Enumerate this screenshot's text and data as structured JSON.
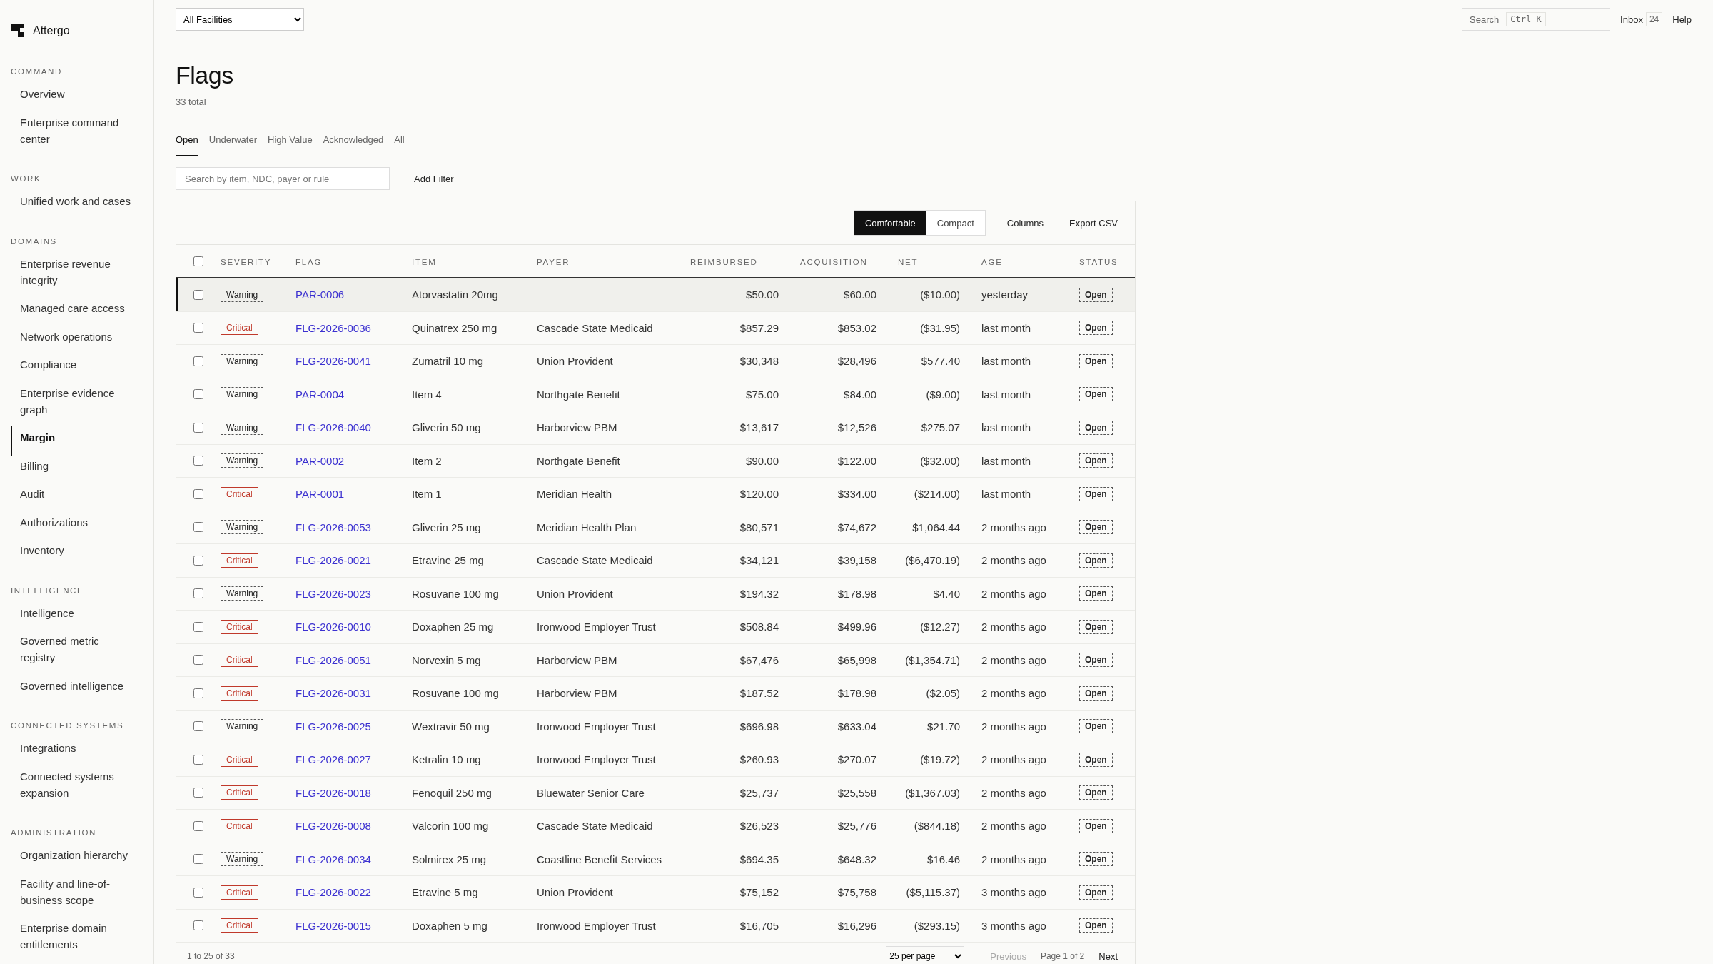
{
  "brand": {
    "name": "Attergo"
  },
  "sidebar": {
    "sections": [
      {
        "heading": "COMMAND",
        "items": [
          {
            "label": "Overview",
            "selected": false
          },
          {
            "label": "Enterprise command center",
            "selected": false
          }
        ]
      },
      {
        "heading": "WORK",
        "items": [
          {
            "label": "Unified work and cases",
            "selected": false
          }
        ]
      },
      {
        "heading": "DOMAINS",
        "items": [
          {
            "label": "Enterprise revenue integrity",
            "selected": false
          },
          {
            "label": "Managed care access",
            "selected": false
          },
          {
            "label": "Network operations",
            "selected": false
          },
          {
            "label": "Compliance",
            "selected": false
          },
          {
            "label": "Enterprise evidence graph",
            "selected": false
          },
          {
            "label": "Margin",
            "selected": true
          },
          {
            "label": "Billing",
            "selected": false
          },
          {
            "label": "Audit",
            "selected": false
          },
          {
            "label": "Authorizations",
            "selected": false
          },
          {
            "label": "Inventory",
            "selected": false
          }
        ]
      },
      {
        "heading": "INTELLIGENCE",
        "items": [
          {
            "label": "Intelligence",
            "selected": false
          },
          {
            "label": "Governed metric registry",
            "selected": false
          },
          {
            "label": "Governed intelligence",
            "selected": false
          }
        ]
      },
      {
        "heading": "CONNECTED SYSTEMS",
        "items": [
          {
            "label": "Integrations",
            "selected": false
          },
          {
            "label": "Connected systems expansion",
            "selected": false
          }
        ]
      },
      {
        "heading": "ADMINISTRATION",
        "items": [
          {
            "label": "Organization hierarchy",
            "selected": false
          },
          {
            "label": "Facility and line-of-business scope",
            "selected": false
          },
          {
            "label": "Enterprise domain entitlements",
            "selected": false
          }
        ]
      }
    ]
  },
  "topbar": {
    "facility_select": "All Facilities",
    "search": {
      "placeholder": "Search",
      "shortcut": "Ctrl K"
    },
    "inbox": {
      "label": "Inbox",
      "count": "24"
    },
    "help": "Help"
  },
  "page": {
    "title": "Flags",
    "subtitle": "33 total"
  },
  "tabs": [
    {
      "label": "Open",
      "selected": true
    },
    {
      "label": "Underwater",
      "selected": false
    },
    {
      "label": "High Value",
      "selected": false
    },
    {
      "label": "Acknowledged",
      "selected": false
    },
    {
      "label": "All",
      "selected": false
    }
  ],
  "filter": {
    "search": {
      "placeholder": "Search by item, NDC, payer or rule"
    },
    "add_filter": "Add Filter"
  },
  "toolbar": {
    "density": [
      {
        "label": "Comfortable",
        "selected": true
      },
      {
        "label": "Compact",
        "selected": false
      }
    ],
    "columns": "Columns",
    "export": "Export CSV"
  },
  "table": {
    "select_all": {
      "checked": false
    },
    "columns": [
      "SEVERITY",
      "FLAG",
      "ITEM",
      "PAYER",
      "REIMBURSED",
      "ACQUISITION",
      "NET",
      "AGE",
      "STATUS"
    ],
    "rows": [
      {
        "selected": true,
        "checked": false,
        "severity": {
          "label": "Warning",
          "kind": "warning"
        },
        "flag": "PAR-0006",
        "item": "Atorvastatin 20mg",
        "payer": "–",
        "reimbursed": "$50.00",
        "acquisition": "$60.00",
        "net": "($10.00)",
        "age": "yesterday",
        "status": "Open"
      },
      {
        "selected": false,
        "checked": false,
        "severity": {
          "label": "Critical",
          "kind": "critical"
        },
        "flag": "FLG-2026-0036",
        "item": "Quinatrex 250 mg",
        "payer": "Cascade State Medicaid",
        "reimbursed": "$857.29",
        "acquisition": "$853.02",
        "net": "($31.95)",
        "age": "last month",
        "status": "Open"
      },
      {
        "selected": false,
        "checked": false,
        "severity": {
          "label": "Warning",
          "kind": "warning"
        },
        "flag": "FLG-2026-0041",
        "item": "Zumatril 10 mg",
        "payer": "Union Provident",
        "reimbursed": "$30,348",
        "acquisition": "$28,496",
        "net": "$577.40",
        "age": "last month",
        "status": "Open"
      },
      {
        "selected": false,
        "checked": false,
        "severity": {
          "label": "Warning",
          "kind": "warning"
        },
        "flag": "PAR-0004",
        "item": "Item 4",
        "payer": "Northgate Benefit",
        "reimbursed": "$75.00",
        "acquisition": "$84.00",
        "net": "($9.00)",
        "age": "last month",
        "status": "Open"
      },
      {
        "selected": false,
        "checked": false,
        "severity": {
          "label": "Warning",
          "kind": "warning"
        },
        "flag": "FLG-2026-0040",
        "item": "Gliverin 50 mg",
        "payer": "Harborview PBM",
        "reimbursed": "$13,617",
        "acquisition": "$12,526",
        "net": "$275.07",
        "age": "last month",
        "status": "Open"
      },
      {
        "selected": false,
        "checked": false,
        "severity": {
          "label": "Warning",
          "kind": "warning"
        },
        "flag": "PAR-0002",
        "item": "Item 2",
        "payer": "Northgate Benefit",
        "reimbursed": "$90.00",
        "acquisition": "$122.00",
        "net": "($32.00)",
        "age": "last month",
        "status": "Open"
      },
      {
        "selected": false,
        "checked": false,
        "severity": {
          "label": "Critical",
          "kind": "critical"
        },
        "flag": "PAR-0001",
        "item": "Item 1",
        "payer": "Meridian Health",
        "reimbursed": "$120.00",
        "acquisition": "$334.00",
        "net": "($214.00)",
        "age": "last month",
        "status": "Open"
      },
      {
        "selected": false,
        "checked": false,
        "severity": {
          "label": "Warning",
          "kind": "warning"
        },
        "flag": "FLG-2026-0053",
        "item": "Gliverin 25 mg",
        "payer": "Meridian Health Plan",
        "reimbursed": "$80,571",
        "acquisition": "$74,672",
        "net": "$1,064.44",
        "age": "2 months ago",
        "status": "Open"
      },
      {
        "selected": false,
        "checked": false,
        "severity": {
          "label": "Critical",
          "kind": "critical"
        },
        "flag": "FLG-2026-0021",
        "item": "Etravine 25 mg",
        "payer": "Cascade State Medicaid",
        "reimbursed": "$34,121",
        "acquisition": "$39,158",
        "net": "($6,470.19)",
        "age": "2 months ago",
        "status": "Open"
      },
      {
        "selected": false,
        "checked": false,
        "severity": {
          "label": "Warning",
          "kind": "warning"
        },
        "flag": "FLG-2026-0023",
        "item": "Rosuvane 100 mg",
        "payer": "Union Provident",
        "reimbursed": "$194.32",
        "acquisition": "$178.98",
        "net": "$4.40",
        "age": "2 months ago",
        "status": "Open"
      },
      {
        "selected": false,
        "checked": false,
        "severity": {
          "label": "Critical",
          "kind": "critical"
        },
        "flag": "FLG-2026-0010",
        "item": "Doxaphen 25 mg",
        "payer": "Ironwood Employer Trust",
        "reimbursed": "$508.84",
        "acquisition": "$499.96",
        "net": "($12.27)",
        "age": "2 months ago",
        "status": "Open"
      },
      {
        "selected": false,
        "checked": false,
        "severity": {
          "label": "Critical",
          "kind": "critical"
        },
        "flag": "FLG-2026-0051",
        "item": "Norvexin 5 mg",
        "payer": "Harborview PBM",
        "reimbursed": "$67,476",
        "acquisition": "$65,998",
        "net": "($1,354.71)",
        "age": "2 months ago",
        "status": "Open"
      },
      {
        "selected": false,
        "checked": false,
        "severity": {
          "label": "Critical",
          "kind": "critical"
        },
        "flag": "FLG-2026-0031",
        "item": "Rosuvane 100 mg",
        "payer": "Harborview PBM",
        "reimbursed": "$187.52",
        "acquisition": "$178.98",
        "net": "($2.05)",
        "age": "2 months ago",
        "status": "Open"
      },
      {
        "selected": false,
        "checked": false,
        "severity": {
          "label": "Warning",
          "kind": "warning"
        },
        "flag": "FLG-2026-0025",
        "item": "Wextravir 50 mg",
        "payer": "Ironwood Employer Trust",
        "reimbursed": "$696.98",
        "acquisition": "$633.04",
        "net": "$21.70",
        "age": "2 months ago",
        "status": "Open"
      },
      {
        "selected": false,
        "checked": false,
        "severity": {
          "label": "Critical",
          "kind": "critical"
        },
        "flag": "FLG-2026-0027",
        "item": "Ketralin 10 mg",
        "payer": "Ironwood Employer Trust",
        "reimbursed": "$260.93",
        "acquisition": "$270.07",
        "net": "($19.72)",
        "age": "2 months ago",
        "status": "Open"
      },
      {
        "selected": false,
        "checked": false,
        "severity": {
          "label": "Critical",
          "kind": "critical"
        },
        "flag": "FLG-2026-0018",
        "item": "Fenoquil 250 mg",
        "payer": "Bluewater Senior Care",
        "reimbursed": "$25,737",
        "acquisition": "$25,558",
        "net": "($1,367.03)",
        "age": "2 months ago",
        "status": "Open"
      },
      {
        "selected": false,
        "checked": false,
        "severity": {
          "label": "Critical",
          "kind": "critical"
        },
        "flag": "FLG-2026-0008",
        "item": "Valcorin 100 mg",
        "payer": "Cascade State Medicaid",
        "reimbursed": "$26,523",
        "acquisition": "$25,776",
        "net": "($844.18)",
        "age": "2 months ago",
        "status": "Open"
      },
      {
        "selected": false,
        "checked": false,
        "severity": {
          "label": "Warning",
          "kind": "warning"
        },
        "flag": "FLG-2026-0034",
        "item": "Solmirex 25 mg",
        "payer": "Coastline Benefit Services",
        "reimbursed": "$694.35",
        "acquisition": "$648.32",
        "net": "$16.46",
        "age": "2 months ago",
        "status": "Open"
      },
      {
        "selected": false,
        "checked": false,
        "severity": {
          "label": "Critical",
          "kind": "critical"
        },
        "flag": "FLG-2026-0022",
        "item": "Etravine 5 mg",
        "payer": "Union Provident",
        "reimbursed": "$75,152",
        "acquisition": "$75,758",
        "net": "($5,115.37)",
        "age": "3 months ago",
        "status": "Open"
      },
      {
        "selected": false,
        "checked": false,
        "severity": {
          "label": "Critical",
          "kind": "critical"
        },
        "flag": "FLG-2026-0015",
        "item": "Doxaphen 5 mg",
        "payer": "Ironwood Employer Trust",
        "reimbursed": "$16,705",
        "acquisition": "$16,296",
        "net": "($293.15)",
        "age": "3 months ago",
        "status": "Open"
      }
    ]
  },
  "pagination": {
    "range": "1 to 25 of 33",
    "per_page": "25 per page",
    "previous": {
      "label": "Previous",
      "disabled": true
    },
    "page": "Page 1 of 2",
    "next": {
      "label": "Next",
      "disabled": false
    }
  }
}
